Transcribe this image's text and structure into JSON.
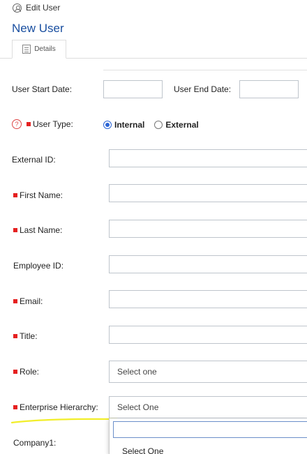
{
  "breadcrumb": {
    "label": "Edit User"
  },
  "page": {
    "title": "New User"
  },
  "tabs": [
    {
      "label": "Details"
    }
  ],
  "fields": {
    "start_date": {
      "label": "User Start Date:"
    },
    "end_date": {
      "label": "User End Date:"
    },
    "user_type": {
      "label": "User Type:",
      "options": [
        "Internal",
        "External"
      ],
      "selected": "Internal"
    },
    "external_id": {
      "label": "External ID:"
    },
    "first_name": {
      "label": "First Name:"
    },
    "last_name": {
      "label": "Last Name:"
    },
    "employee_id": {
      "label": "Employee ID:"
    },
    "email": {
      "label": "Email:"
    },
    "title": {
      "label": "Title:"
    },
    "role": {
      "label": "Role:",
      "value": "Select one"
    },
    "enterprise_hierarchy": {
      "label": "Enterprise Hierarchy:",
      "value": "Select One"
    },
    "company1": {
      "label": "Company1:"
    }
  },
  "dropdown": {
    "options": [
      "Select One"
    ]
  },
  "colors": {
    "accent": "#2a64d6",
    "title": "#1a4fa0",
    "required": "#e52020",
    "highlight": "#f2ee2a"
  }
}
